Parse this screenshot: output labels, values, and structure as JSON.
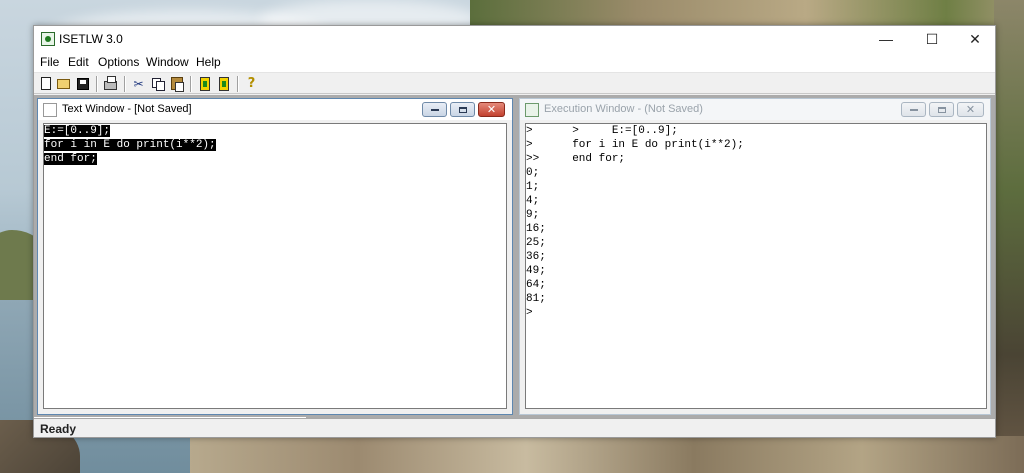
{
  "app": {
    "title": "ISETLW 3.0",
    "controls": {
      "minimize": "—",
      "maximize": "☐",
      "close": "✕"
    }
  },
  "menu": [
    "File",
    "Edit",
    "Options",
    "Window",
    "Help"
  ],
  "toolbar": {
    "buttons": [
      "new-doc-icon",
      "open-folder-icon",
      "save-disk-icon",
      "print-icon",
      "cut-icon",
      "copy-icon",
      "paste-icon",
      "run-icon",
      "run-selection-icon",
      "help-icon"
    ]
  },
  "text_window": {
    "title": "Text Window - [Not Saved]",
    "lines": [
      "E:=[0..9];",
      "for i in E do print(i**2);",
      "end for;"
    ],
    "close": "✕"
  },
  "exec_window": {
    "title": "Execution Window - (Not Saved)",
    "lines": [
      ">      >     E:=[0..9];",
      ">      for i in E do print(i**2);",
      ">>     end for;",
      "0;",
      "1;",
      "4;",
      "9;",
      "16;",
      "25;",
      "36;",
      "49;",
      "64;",
      "81;",
      ">"
    ],
    "close": "✕"
  },
  "status": {
    "text": "Ready"
  },
  "colors": {
    "selection": "#000000",
    "mdi_background": "#ababab",
    "active_border": "#5e87b0"
  }
}
